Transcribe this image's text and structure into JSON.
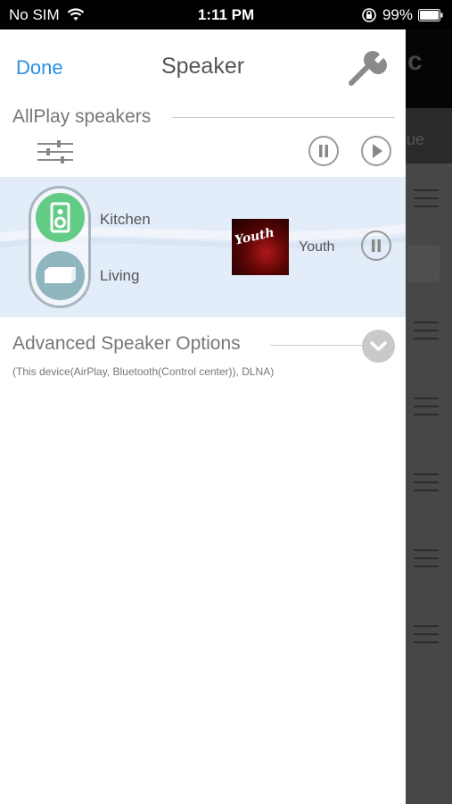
{
  "status_bar": {
    "carrier": "No SIM",
    "time": "1:11 PM",
    "battery": "99%",
    "icons": [
      "wifi-icon",
      "rotation-lock-icon",
      "battery-icon"
    ]
  },
  "background": {
    "header_char": "c",
    "tab_text": "ue"
  },
  "drawer": {
    "done_label": "Done",
    "title": "Speaker",
    "settings_icon": "wrench-icon"
  },
  "allplay": {
    "title": "AllPlay speakers",
    "controls": [
      "equalizer-icon",
      "pause-all-icon",
      "play-all-icon"
    ],
    "group": {
      "speakers": [
        {
          "name": "Kitchen",
          "icon": "speaker-icon",
          "color": "#62cc84"
        },
        {
          "name": "Living",
          "icon": "soundbar-icon",
          "color": "#8fb6be"
        }
      ],
      "album_art_text": "Youth",
      "track": "Youth",
      "control": "pause-icon"
    }
  },
  "advanced": {
    "title": "Advanced Speaker Options",
    "subtitle": "(This device(AirPlay, Bluetooth(Control center)), DLNA)",
    "expand_icon": "chevron-down-icon"
  },
  "colors": {
    "accent": "#2a8fe0",
    "panel_bg": "#e3ecf9",
    "text_gray": "#777777"
  }
}
